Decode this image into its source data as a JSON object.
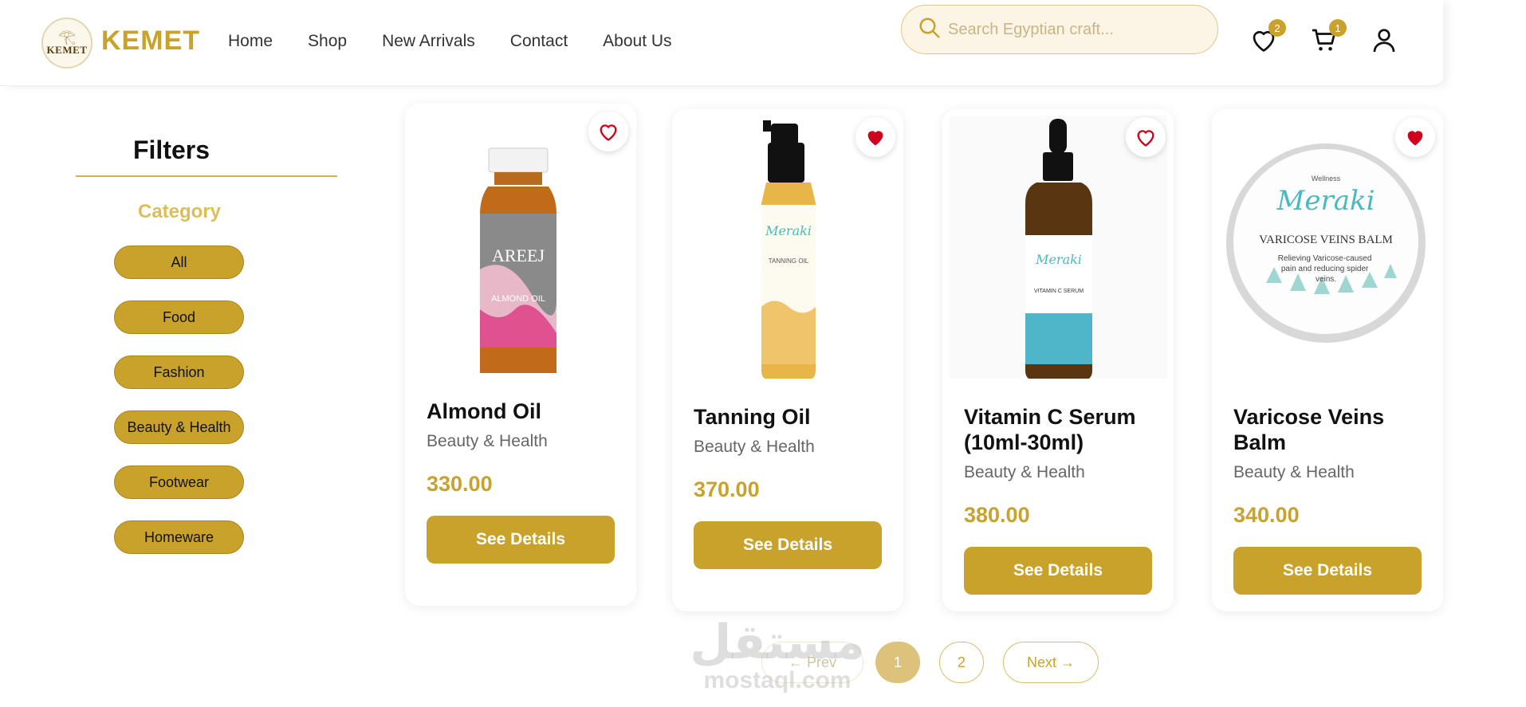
{
  "header": {
    "logo_text": "KEMET",
    "brand": "KEMET",
    "nav": [
      "Home",
      "Shop",
      "New Arrivals",
      "Contact",
      "About Us"
    ],
    "search_placeholder": "Search Egyptian craft...",
    "wishlist_count": "2",
    "cart_count": "1"
  },
  "sidebar": {
    "title": "Filters",
    "category_title": "Category",
    "categories": [
      "All",
      "Food",
      "Fashion",
      "Beauty & Health",
      "Footwear",
      "Homeware"
    ]
  },
  "products": [
    {
      "name": "Almond Oil",
      "category": "Beauty & Health",
      "price": "330.00",
      "button": "See Details",
      "favorited": false,
      "image_label": "AREEJ",
      "image_sub": "ALMOND OIL"
    },
    {
      "name": "Tanning Oil",
      "category": "Beauty & Health",
      "price": "370.00",
      "button": "See Details",
      "favorited": true,
      "image_label": "Meraki",
      "image_sub": "TANNING OIL"
    },
    {
      "name": "Vitamin C Serum (10ml-30ml)",
      "category": "Beauty & Health",
      "price": "380.00",
      "button": "See Details",
      "favorited": false,
      "image_label": "Meraki",
      "image_sub": "VITAMIN C SERUM"
    },
    {
      "name": "Varicose Veins Balm",
      "category": "Beauty & Health",
      "price": "340.00",
      "button": "See Details",
      "favorited": true,
      "image_label": "Meraki",
      "image_sub": "VARICOSE VEINS BALM",
      "image_desc": "Relieving Varicose-caused pain and reducing spider veins.",
      "image_top": "Wellness"
    }
  ],
  "pagination": {
    "prev": "← Prev",
    "pages": [
      "1",
      "2"
    ],
    "next": "Next →",
    "current": "1"
  },
  "watermark": {
    "arabic": "مستقل",
    "latin": "mostaql.com"
  },
  "colors": {
    "accent": "#c9a22b",
    "heart": "#d0021b"
  }
}
